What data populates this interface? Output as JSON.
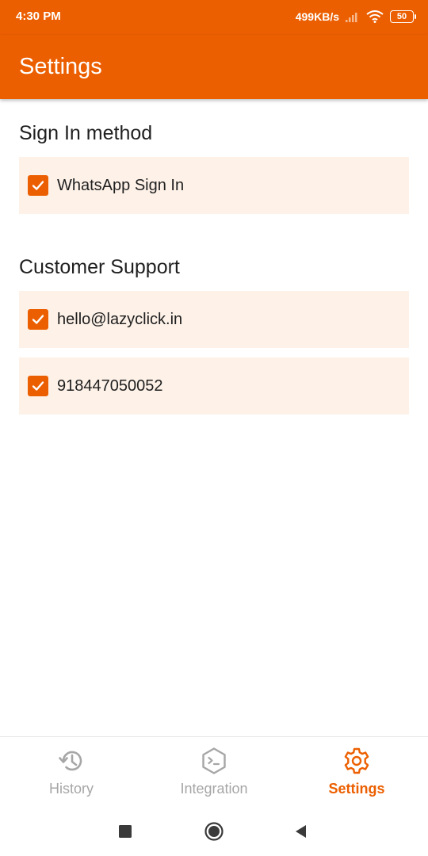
{
  "status_bar": {
    "time": "4:30 PM",
    "network_speed": "499KB/s",
    "battery": "50"
  },
  "app_bar": {
    "title": "Settings"
  },
  "sections": [
    {
      "title": "Sign In method",
      "options": [
        {
          "label": "WhatsApp Sign In",
          "checked": true
        }
      ]
    },
    {
      "title": "Customer Support",
      "options": [
        {
          "label": "hello@lazyclick.in",
          "checked": true
        },
        {
          "label": "918447050052",
          "checked": true
        }
      ]
    }
  ],
  "bottom_nav": {
    "items": [
      {
        "label": "History",
        "icon": "history-icon",
        "active": false
      },
      {
        "label": "Integration",
        "icon": "terminal-icon",
        "active": false
      },
      {
        "label": "Settings",
        "icon": "gear-icon",
        "active": true
      }
    ]
  },
  "colors": {
    "accent": "#ec5f00",
    "option_background": "#fdf1e8",
    "inactive_nav": "#a6a6a6"
  }
}
